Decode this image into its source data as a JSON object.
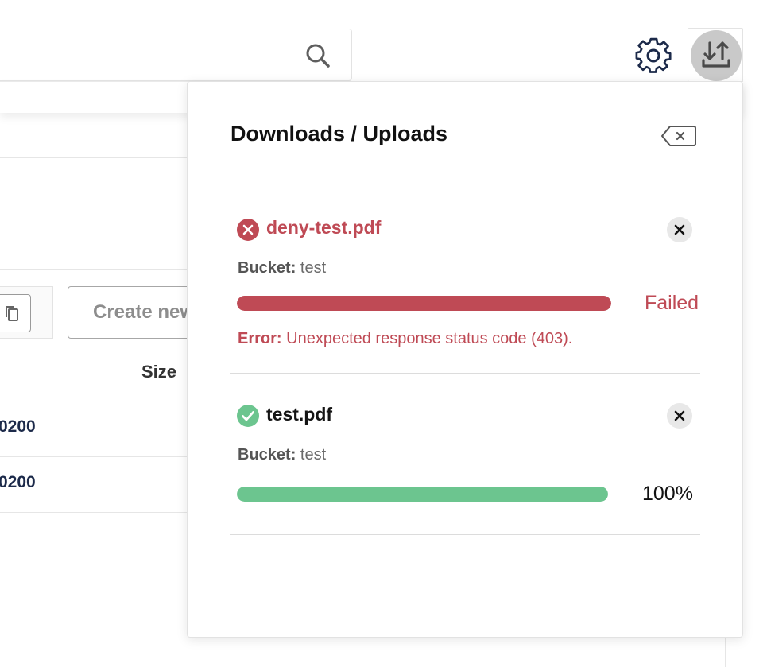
{
  "header": {
    "search": {
      "placeholder": ""
    },
    "settings_icon": "gear-icon",
    "transfers_icon": "upload-download-icon"
  },
  "background": {
    "create_button_label": "Create new",
    "table": {
      "size_header": "Size",
      "rows": [
        "0200",
        "0200"
      ]
    }
  },
  "transfers_panel": {
    "title": "Downloads / Uploads",
    "clear_icon": "backspace-clear-icon",
    "items": [
      {
        "file_name": "deny-test.pdf",
        "state": "error",
        "bucket_label": "Bucket:",
        "bucket": "test",
        "progress": 1.0,
        "progress_color": "#bf4a55",
        "status_text": "Failed",
        "error_label": "Error:",
        "error_message": "Unexpected response status code (403)."
      },
      {
        "file_name": "test.pdf",
        "state": "success",
        "bucket_label": "Bucket:",
        "bucket": "test",
        "progress": 1.0,
        "progress_color": "#6cc58f",
        "status_text": "100%"
      }
    ]
  },
  "colors": {
    "error": "#bf4a55",
    "success": "#6cc58f",
    "navy": "#1c2a4a"
  }
}
